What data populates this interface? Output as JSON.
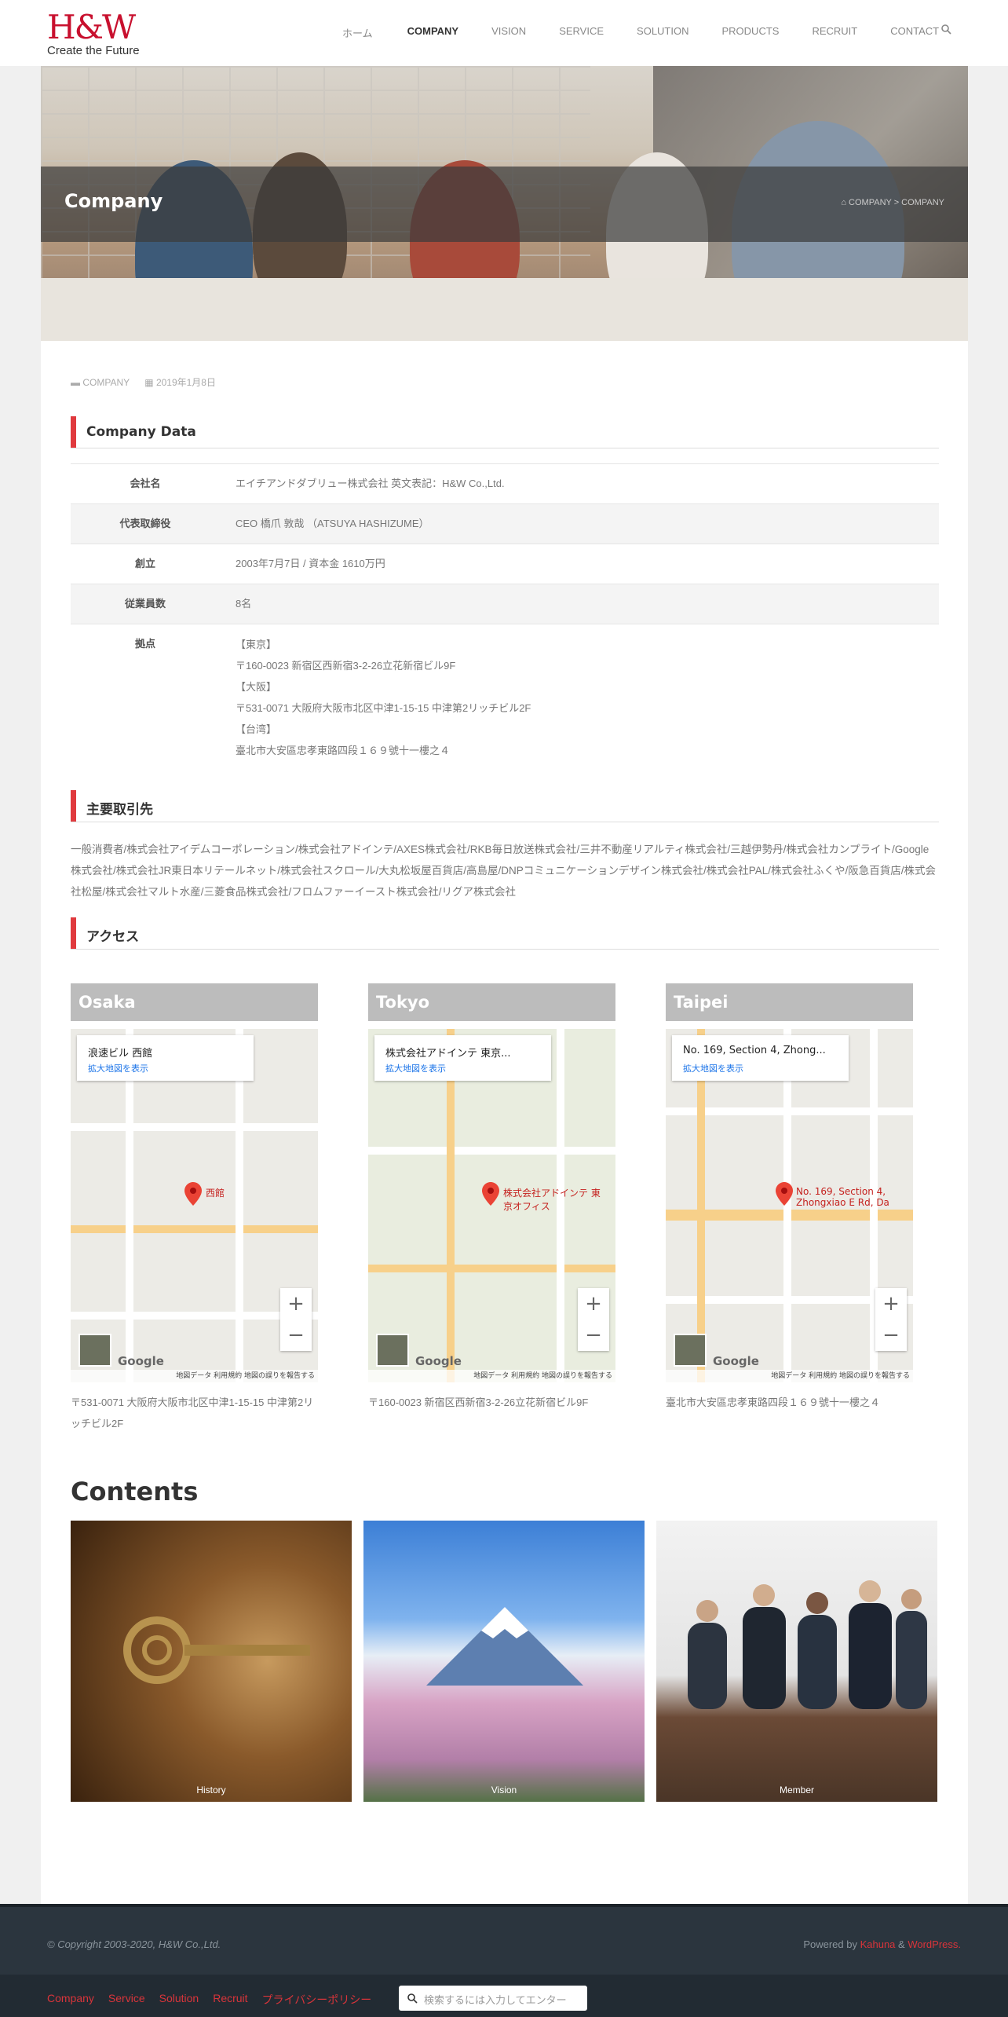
{
  "header": {
    "logo_mark": "H&W",
    "logo_sub": "Create the Future",
    "nav": [
      "ホーム",
      "COMPANY",
      "VISION",
      "SERVICE",
      "SOLUTION",
      "PRODUCTS",
      "RECRUIT",
      "CONTACT"
    ]
  },
  "hero": {
    "title": "Company",
    "breadcrumb": "COMPANY  >  COMPANY"
  },
  "meta": {
    "category": "COMPANY",
    "date": "2019年1月8日"
  },
  "company_data": {
    "heading": "Company Data",
    "rows": [
      {
        "k": "会社名",
        "v": "エイチアンドダブリュー株式会社 英文表記：H&W Co.,Ltd."
      },
      {
        "k": "代表取締役",
        "v": "CEO 橋爪 敦哉 （ATSUYA HASHIZUME）"
      },
      {
        "k": "創立",
        "v": "2003年7月7日 / 資本金 1610万円"
      },
      {
        "k": "従業員数",
        "v": "8名"
      },
      {
        "k": "拠点",
        "lines": [
          "【東京】",
          "〒160-0023 新宿区西新宿3-2-26立花新宿ビル9F",
          "【大阪】",
          "〒531-0071 大阪府大阪市北区中津1-15-15 中津第2リッチビル2F",
          "【台湾】",
          "臺北市大安區忠孝東路四段１６９號十一樓之４"
        ]
      }
    ]
  },
  "clients": {
    "heading": "主要取引先",
    "text": "一般消費者/株式会社アイデムコーポレーション/株式会社アドインテ/AXES株式会社/RKB毎日放送株式会社/三井不動産リアルティ株式会社/三越伊勢丹/株式会社カンプライト/Google株式会社/株式会社JR東日本リテールネット/株式会社スクロール/大丸松坂屋百貨店/高島屋/DNPコミュニケーションデザイン株式会社/株式会社PAL/株式会社ふくや/阪急百貨店/株式会社松屋/株式会社マルト水産/三菱食品株式会社/フロムファーイースト株式会社/リグア株式会社"
  },
  "access": {
    "heading": "アクセス",
    "maps": [
      {
        "city": "Osaka",
        "place": "浪速ビル 西館",
        "link": "拡大地図を表示",
        "pin": "西館",
        "addr": "〒531-0071 大阪府大阪市北区中津1-15-15 中津第2リッチビル2F"
      },
      {
        "city": "Tokyo",
        "place": "株式会社アドインテ 東京...",
        "link": "拡大地図を表示",
        "pin": "株式会社アドインテ 東京オフィス",
        "addr": "〒160-0023 新宿区西新宿3-2-26立花新宿ビル9F"
      },
      {
        "city": "Taipei",
        "place": "No. 169, Section 4, Zhong...",
        "link": "拡大地図を表示",
        "pin": "No. 169, Section 4, Zhongxiao E Rd, Da",
        "addr": "臺北市大安區忠孝東路四段１６９號十一樓之４"
      }
    ],
    "map_footer": "地図データ  利用規約  地図の誤りを報告する",
    "google": "Google"
  },
  "contents": {
    "heading": "Contents",
    "tiles": [
      "History",
      "Vision",
      "Member"
    ]
  },
  "footer": {
    "copyright": "© Copyright 2003-2020, H&W Co.,Ltd.",
    "powered_prefix": "Powered by ",
    "powered_kahuna": "Kahuna",
    "powered_amp": " & ",
    "powered_wp": "WordPress.",
    "links": [
      "Company",
      "Service",
      "Solution",
      "Recruit",
      "プライバシーポリシー"
    ],
    "search_placeholder": "検索するには入力してエンター"
  }
}
